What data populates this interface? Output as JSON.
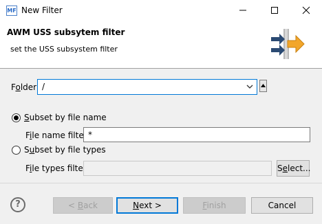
{
  "window": {
    "title": "New Filter",
    "app_icon_text": "MF"
  },
  "header": {
    "title": "AWM USS subsytem filter",
    "subtitle": "set the USS subsystem filter",
    "graphic": "filter-arrows-icon"
  },
  "folder": {
    "label_pre": "F",
    "label_u": "o",
    "label_post": "lder:",
    "value": "/"
  },
  "subset_name": {
    "label_pre": "",
    "label_u": "S",
    "label_post": "ubset by file name",
    "checked": true
  },
  "file_name_filter": {
    "label_pre": "F",
    "label_u": "i",
    "label_post": "le name filter:",
    "value": "*"
  },
  "subset_types": {
    "label_pre": "S",
    "label_u": "u",
    "label_post": "bset by file types",
    "checked": false
  },
  "file_types_filter": {
    "label_pre": "F",
    "label_u": "i",
    "label_post": "le types filter:",
    "value": ""
  },
  "select_button": {
    "label_pre": "S",
    "label_u": "e",
    "label_post": "lect..."
  },
  "footer": {
    "back": {
      "label_pre": "< ",
      "label_u": "B",
      "label_post": "ack"
    },
    "next": {
      "label_pre": "",
      "label_u": "N",
      "label_post": "ext >"
    },
    "finish": {
      "label_pre": "",
      "label_u": "F",
      "label_post": "inish"
    },
    "cancel": "Cancel"
  },
  "colors": {
    "accent": "#0078d7",
    "header_bg": "#ffffff",
    "body_bg": "#f0f0f0"
  }
}
